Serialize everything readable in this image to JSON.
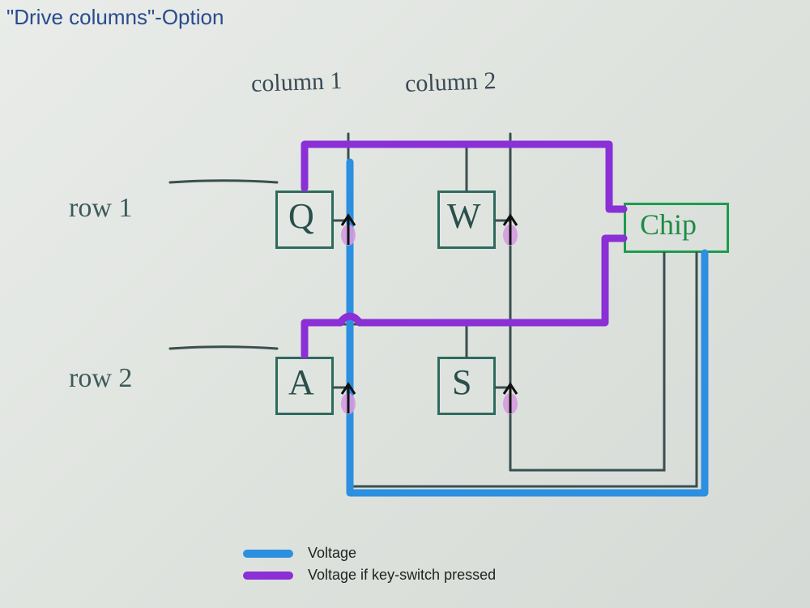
{
  "title": "\"Drive columns\"-Option",
  "labels": {
    "row1": "row 1",
    "row2": "row 2",
    "col1": "column 1",
    "col2": "column 2",
    "chip": "Chip"
  },
  "keys": {
    "r1c1": "Q",
    "r1c2": "W",
    "r2c1": "A",
    "r2c2": "S"
  },
  "legend": {
    "voltage": "Voltage",
    "voltage_pressed": "Voltage if key-switch pressed"
  },
  "colors": {
    "voltage": "#2c8fe0",
    "voltage_pressed": "#8b2fd6",
    "pen_dark": "#3a4f4f",
    "pen_green": "#2e6b5f",
    "chip_green": "#1e9c4d",
    "diode_pink": "#d49adf"
  },
  "diagram": {
    "type": "keyboard-matrix",
    "rows": [
      "row1",
      "row2"
    ],
    "columns": [
      "column1",
      "column2"
    ],
    "switches": [
      {
        "row": "row1",
        "col": "column1",
        "key": "Q"
      },
      {
        "row": "row1",
        "col": "column2",
        "key": "W"
      },
      {
        "row": "row2",
        "col": "column1",
        "key": "A"
      },
      {
        "row": "row2",
        "col": "column2",
        "key": "S"
      }
    ],
    "driven": "columns",
    "highlighted_drive_column": "column1",
    "highlighted_sense_rows": [
      "row1",
      "row2"
    ],
    "diode_direction": "column-to-row"
  }
}
